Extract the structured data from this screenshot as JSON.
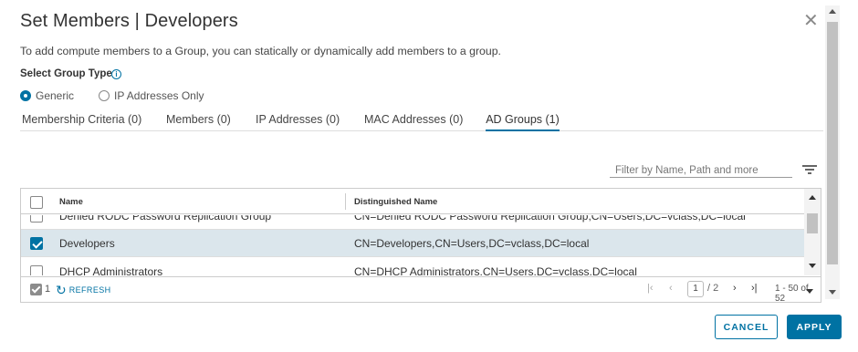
{
  "dialog": {
    "title": "Set Members | Developers",
    "description": "To add compute members to a Group, you can statically or dynamically add members to a group."
  },
  "group_type": {
    "label": "Select Group Type",
    "info_icon": "i",
    "options": [
      {
        "label": "Generic",
        "checked": true
      },
      {
        "label": "IP Addresses Only",
        "checked": false
      }
    ]
  },
  "tabs": [
    {
      "label": "Membership Criteria (0)",
      "active": false
    },
    {
      "label": "Members (0)",
      "active": false
    },
    {
      "label": "IP Addresses (0)",
      "active": false
    },
    {
      "label": "MAC Addresses (0)",
      "active": false
    },
    {
      "label": "AD Groups (1)",
      "active": true
    }
  ],
  "filter": {
    "placeholder": "Filter by Name, Path and more"
  },
  "grid": {
    "columns": {
      "name": "Name",
      "dn": "Distinguished Name"
    },
    "rows": [
      {
        "name": "Denied RODC Password Replication Group",
        "dn": "CN=Denied RODC Password Replication Group,CN=Users,DC=vclass,DC=local",
        "checked": false
      },
      {
        "name": "Developers",
        "dn": "CN=Developers,CN=Users,DC=vclass,DC=local",
        "checked": true
      },
      {
        "name": "DHCP Administrators",
        "dn": "CN=DHCP Administrators,CN=Users,DC=vclass,DC=local",
        "checked": false
      }
    ],
    "footer": {
      "selected_count": "1",
      "refresh_label": "REFRESH",
      "page_current": "1",
      "page_total": "/ 2",
      "range": "1 - 50 of 52"
    }
  },
  "buttons": {
    "cancel": "CANCEL",
    "apply": "APPLY"
  },
  "colors": {
    "accent": "#0072a3",
    "selected_row": "#dbe6ec"
  }
}
